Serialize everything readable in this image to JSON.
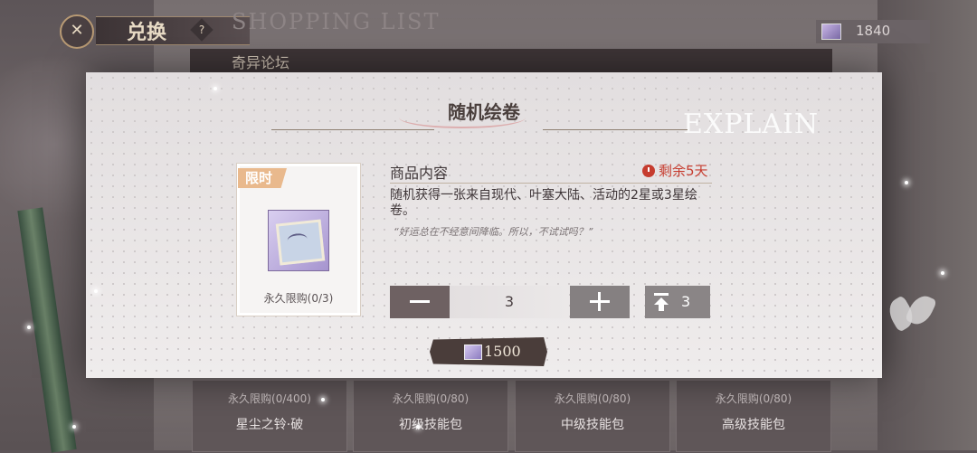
{
  "header": {
    "title": "兑换",
    "subtitle": "SHOPPING LIST",
    "help_symbol": "?",
    "currency_value": "1840"
  },
  "tab": {
    "label": "奇异论坛"
  },
  "modal": {
    "title": "随机绘卷",
    "watermark": "EXPLAIN",
    "item": {
      "tag": "限时",
      "limit": "永久限购(0/3)"
    },
    "content_header": "商品内容",
    "time_left": "剩余5天",
    "description": "随机获得一张来自现代、叶塞大陆、活动的2星或3星绘卷。",
    "flavor": "“好运总在不经意间降临。所以，不试试吗？”",
    "quantity": "3",
    "max_quantity": "3",
    "price": "1500"
  },
  "shop_items": [
    {
      "limit": "永久限购(0/400)",
      "name": "星尘之铃·破"
    },
    {
      "limit": "永久限购(0/80)",
      "name": "初级技能包"
    },
    {
      "limit": "永久限购(0/80)",
      "name": "中级技能包"
    },
    {
      "limit": "永久限购(0/80)",
      "name": "高级技能包"
    }
  ],
  "colors": {
    "accent_red": "#c63c2f",
    "tag_orange": "#e9b98d",
    "button_dark": "#6e6162",
    "button_gray": "#858081"
  },
  "icons": [
    "emblem-icon",
    "help-icon",
    "gem-icon",
    "clock-icon",
    "minus-icon",
    "plus-icon",
    "max-icon",
    "butterfly-icon"
  ]
}
